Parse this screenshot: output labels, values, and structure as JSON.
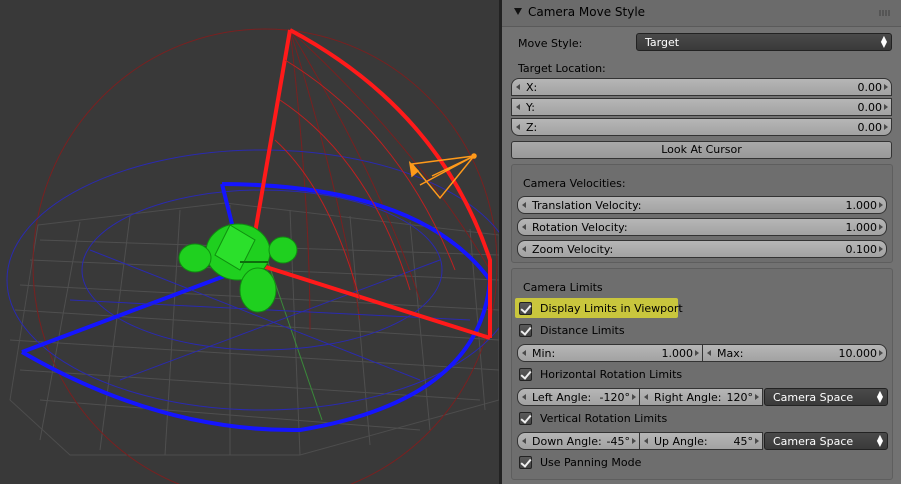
{
  "panel": {
    "title": "Camera Move Style",
    "move_style_label": "Move Style:",
    "move_style_value": "Target",
    "target_location_label": "Target Location:",
    "target": {
      "x_label": "X:",
      "x_value": "0.00",
      "y_label": "Y:",
      "y_value": "0.00",
      "z_label": "Z:",
      "z_value": "0.00"
    },
    "look_at_cursor": "Look At Cursor",
    "velocities": {
      "heading": "Camera Velocities:",
      "translation_label": "Translation Velocity:",
      "translation_value": "1.000",
      "rotation_label": "Rotation Velocity:",
      "rotation_value": "1.000",
      "zoom_label": "Zoom Velocity:",
      "zoom_value": "0.100"
    },
    "limits": {
      "heading": "Camera Limits",
      "display_limits": "Display Limits in Viewport",
      "distance_limits": "Distance Limits",
      "min_label": "Min:",
      "min_value": "1.000",
      "max_label": "Max:",
      "max_value": "10.000",
      "horizontal": "Horizontal Rotation Limits",
      "left_angle_label": "Left Angle:",
      "left_angle_value": "-120°",
      "right_angle_label": "Right Angle:",
      "right_angle_value": "120°",
      "h_space": "Camera Space",
      "vertical": "Vertical Rotation Limits",
      "down_angle_label": "Down Angle:",
      "down_angle_value": "-45°",
      "up_angle_label": "Up Angle:",
      "up_angle_value": "45°",
      "v_space": "Camera Space",
      "panning": "Use Panning Mode"
    }
  },
  "colors": {
    "viewport_bg": "#393939",
    "panel_bg": "#727272",
    "vertical_limit": "#ff1a1a",
    "horizontal_limit": "#1a1aff",
    "highlight": "#c9c63d",
    "object": "#1fd01f",
    "camera": "#ff9a1a"
  }
}
